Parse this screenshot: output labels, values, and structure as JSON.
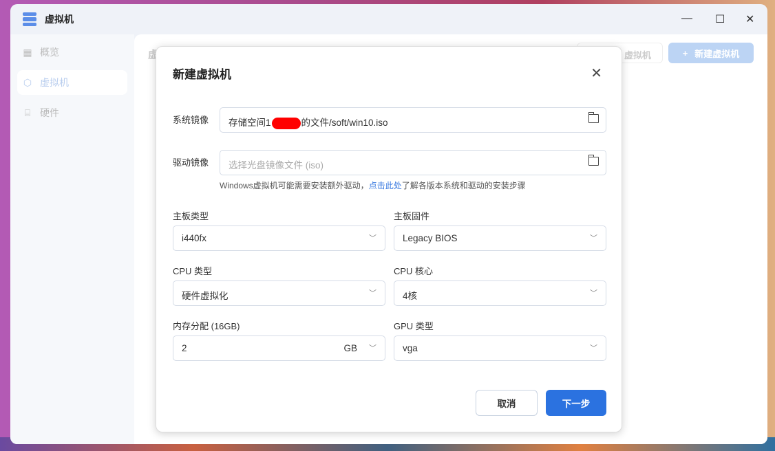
{
  "window": {
    "title": "虚拟机",
    "minimize": "—",
    "maximize": "☐",
    "close": "✕"
  },
  "sidebar": {
    "items": [
      {
        "label": "概览",
        "icon": "grid-icon"
      },
      {
        "label": "虚拟机",
        "icon": "cube-icon"
      },
      {
        "label": "硬件",
        "icon": "drive-icon"
      }
    ]
  },
  "main": {
    "heading": "虚",
    "ghost_button": "虚拟机",
    "new_button": "新建虚拟机",
    "new_button_icon": "+"
  },
  "dialog": {
    "title": "新建虚拟机",
    "system_image": {
      "label": "系统镜像",
      "value_prefix": "存储空间1",
      "value_suffix": "的文件/soft/win10.iso"
    },
    "driver_image": {
      "label": "驱动镜像",
      "placeholder": "选择光盘镜像文件 (iso)"
    },
    "hint": {
      "before": "Windows虚拟机可能需要安装额外驱动，",
      "link": "点击此处",
      "after": "了解各版本系统和驱动的安装步骤"
    },
    "board_type": {
      "label": "主板类型",
      "value": "i440fx"
    },
    "board_firmware": {
      "label": "主板固件",
      "value": "Legacy BIOS"
    },
    "cpu_type": {
      "label": "CPU 类型",
      "value": "硬件虚拟化"
    },
    "cpu_cores": {
      "label": "CPU 核心",
      "value": "4核"
    },
    "memory": {
      "label": "内存分配 (16GB)",
      "value": "2",
      "unit": "GB"
    },
    "gpu_type": {
      "label": "GPU 类型",
      "value": "vga"
    },
    "cancel": "取消",
    "next": "下一步"
  }
}
